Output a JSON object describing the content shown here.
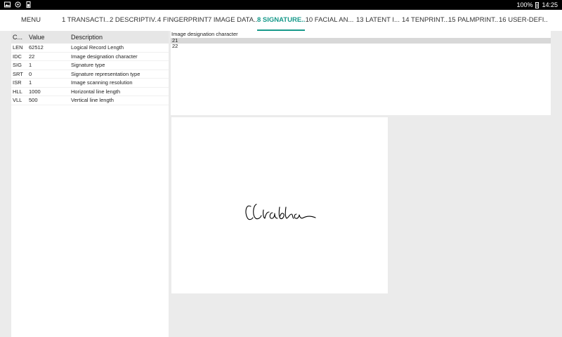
{
  "status": {
    "battery": "100%",
    "time": "14:25"
  },
  "tabs": [
    {
      "label": "MENU",
      "active": false
    },
    {
      "label": "1 TRANSACTI...",
      "active": false
    },
    {
      "label": "2 DESCRIPTIV...",
      "active": false
    },
    {
      "label": "4 FINGERPRINT...",
      "active": false
    },
    {
      "label": "7 IMAGE DATA...",
      "active": false
    },
    {
      "label": "8 SIGNATURE...",
      "active": true
    },
    {
      "label": "10 FACIAL AN...",
      "active": false
    },
    {
      "label": "13 LATENT I...",
      "active": false
    },
    {
      "label": "14 TENPRINT...",
      "active": false
    },
    {
      "label": "15 PALMPRINT...",
      "active": false
    },
    {
      "label": "16 USER-DEFI...",
      "active": false
    }
  ],
  "table": {
    "headers": [
      "C...",
      "Value",
      "Description"
    ],
    "rows": [
      [
        "LEN",
        "62512",
        "Logical Record Length"
      ],
      [
        "IDC",
        "22",
        "Image designation character"
      ],
      [
        "SIG",
        "1",
        "Signature type"
      ],
      [
        "SRT",
        "0",
        "Signature representation type"
      ],
      [
        "ISR",
        "1",
        "Image scanning resolution"
      ],
      [
        "HLL",
        "1000",
        "Horizontal line length"
      ],
      [
        "VLL",
        "500",
        "Vertical line length"
      ]
    ]
  },
  "detail": {
    "title": "Image designation character",
    "options": [
      "21",
      "22"
    ],
    "selected": "21"
  },
  "colors": {
    "accent": "#17998a"
  }
}
